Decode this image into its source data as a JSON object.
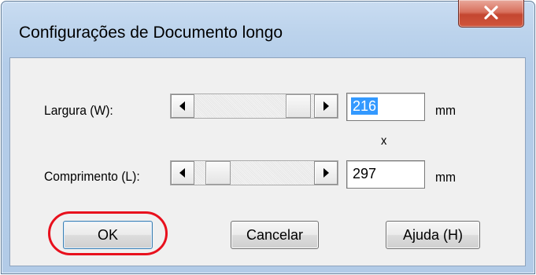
{
  "window": {
    "title": "Configurações de Documento longo",
    "close_label": "X"
  },
  "width_row": {
    "label": "Largura (W):",
    "value": "216",
    "unit": "mm",
    "scroll_position": 0.82
  },
  "separator": "x",
  "length_row": {
    "label": "Comprimento (L):",
    "value": "297",
    "unit": "mm",
    "scroll_position": 0.0
  },
  "buttons": {
    "ok": "OK",
    "cancel": "Cancelar",
    "help": "Ajuda (H)"
  },
  "highlight_color": "#e8101d",
  "icons": [
    "close-icon",
    "arrow-left-icon",
    "arrow-right-icon"
  ]
}
